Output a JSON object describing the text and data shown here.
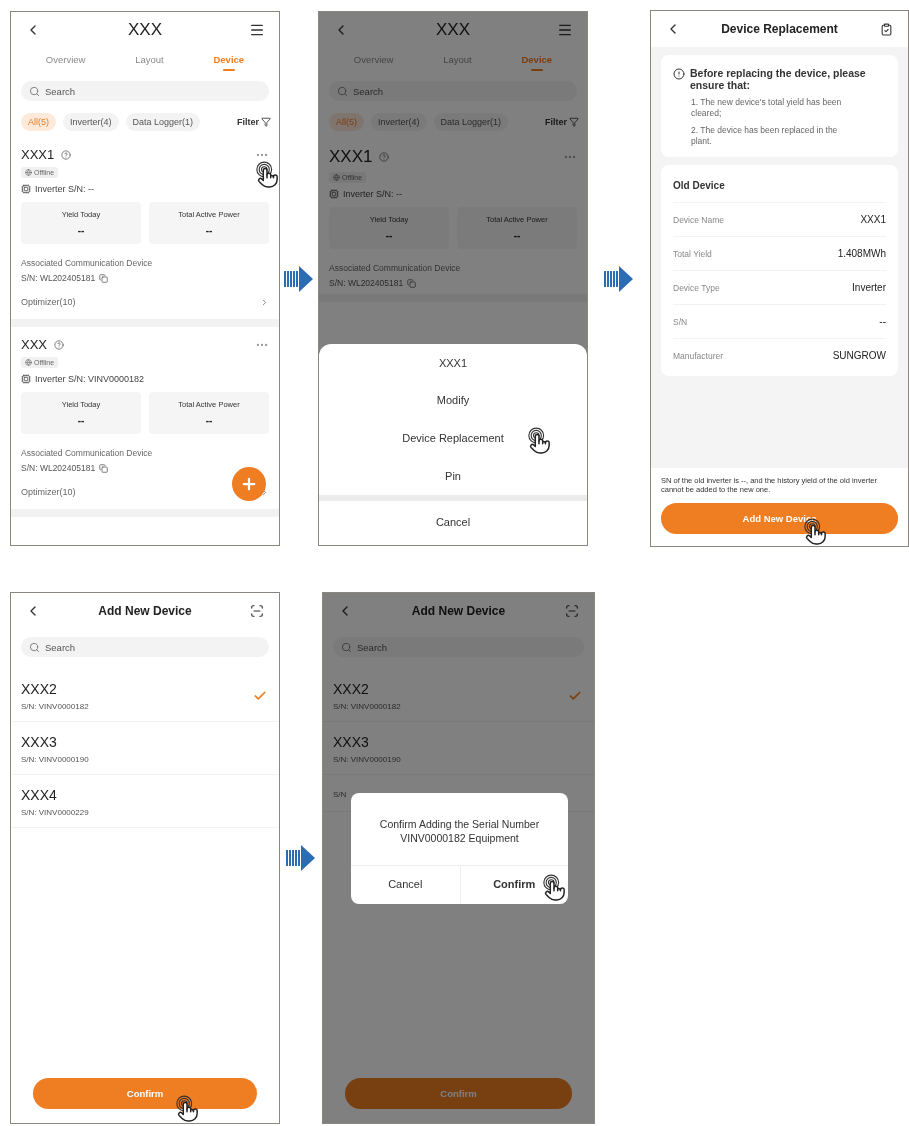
{
  "screens": [
    {
      "kind": "device_list",
      "header": {
        "title": "XXX"
      },
      "tabs": [
        {
          "label": "Overview",
          "selected": false
        },
        {
          "label": "Layout",
          "selected": false
        },
        {
          "label": "Device",
          "selected": true
        }
      ],
      "search": {
        "placeholder": "Search"
      },
      "filters": [
        {
          "label": "All(5)",
          "selected": true
        },
        {
          "label": "Inverter(4)",
          "selected": false
        },
        {
          "label": "Data Logger(1)",
          "selected": false
        }
      ],
      "filter_button": "Filter",
      "devices": [
        {
          "name": "XXX1",
          "status": "Offline",
          "type_sn": "Inverter S/N: --",
          "metrics": [
            {
              "label": "Yield Today",
              "value": "--"
            },
            {
              "label": "Total Active Power",
              "value": "--"
            }
          ],
          "comm_label": "Associated Communication Device",
          "comm_sn": "S/N: WL202405181",
          "optimizer": "Optimizer(10)",
          "tapped": true
        },
        {
          "name": "XXX",
          "status": "Offline",
          "type_sn": "Inverter S/N: VINV0000182",
          "metrics": [
            {
              "label": "Yield Today",
              "value": "--"
            },
            {
              "label": "Total Active Power",
              "value": "--"
            }
          ],
          "comm_label": "Associated Communication Device",
          "comm_sn": "S/N: WL202405181",
          "optimizer": "Optimizer(10)",
          "tapped": false
        }
      ]
    },
    {
      "kind": "device_list",
      "header": {
        "title": "XXX"
      },
      "tabs": [
        {
          "label": "Overview",
          "selected": false
        },
        {
          "label": "Layout",
          "selected": false
        },
        {
          "label": "Device",
          "selected": true
        }
      ],
      "search": {
        "placeholder": "Search"
      },
      "filters": [
        {
          "label": "All(5)",
          "selected": true
        },
        {
          "label": "Inverter(4)",
          "selected": false
        },
        {
          "label": "Data Logger(1)",
          "selected": false
        }
      ],
      "filter_button": "Filter",
      "devices": [
        {
          "name": "XXX1",
          "status": "Offline",
          "type_sn": "Inverter S/N: --",
          "metrics": [
            {
              "label": "Yield Today",
              "value": "--"
            },
            {
              "label": "Total Active Power",
              "value": "--"
            }
          ],
          "comm_label": "Associated Communication Device",
          "comm_sn": "S/N: WL202405181",
          "tapped": false
        }
      ],
      "sheet": {
        "title": "XXX1",
        "options": [
          {
            "label": "Modify",
            "tapped": false
          },
          {
            "label": "Device Replacement",
            "tapped": true
          },
          {
            "label": "Pin",
            "tapped": false
          }
        ],
        "cancel": "Cancel"
      }
    },
    {
      "kind": "replacement",
      "header": {
        "title": "Device Replacement"
      },
      "notice": {
        "heading": "Before replacing the device, please ensure that:",
        "items": [
          "1. The new device's total yield has been cleared;",
          "2. The device has been replaced in the plant."
        ]
      },
      "old_device": {
        "heading": "Old Device",
        "rows": [
          {
            "label": "Device Name",
            "value": "XXX1"
          },
          {
            "label": "Total Yield",
            "value": "1.408MWh"
          },
          {
            "label": "Device Type",
            "value": "Inverter"
          },
          {
            "label": "S/N",
            "value": "--"
          },
          {
            "label": "Manufacturer",
            "value": "SUNGROW"
          }
        ]
      },
      "footnote": "SN of the old inverter is --, and the history yield of the old inverter cannot be added to the new one.",
      "button": {
        "label": "Add New Device",
        "tapped": true
      }
    },
    {
      "kind": "add_device",
      "header": {
        "title": "Add New Device"
      },
      "search": {
        "placeholder": "Search"
      },
      "devices": [
        {
          "name": "XXX2",
          "sn": "S/N: VINV0000182",
          "selected": true
        },
        {
          "name": "XXX3",
          "sn": "S/N: VINV0000190",
          "selected": false
        },
        {
          "name": "XXX4",
          "sn": "S/N: VINV0000229",
          "selected": false
        }
      ],
      "button": {
        "label": "Confirm",
        "tapped": true
      }
    },
    {
      "kind": "add_device",
      "header": {
        "title": "Add New Device"
      },
      "search": {
        "placeholder": "Search"
      },
      "devices": [
        {
          "name": "XXX2",
          "sn": "S/N: VINV0000182",
          "selected": true
        },
        {
          "name": "XXX3",
          "sn": "S/N: VINV0000190",
          "selected": false
        },
        {
          "sn": "S/N",
          "selected": false
        }
      ],
      "dialog": {
        "message": "Confirm Adding the Serial Number VINV0000182 Equipment",
        "buttons": [
          {
            "label": "Cancel",
            "kind": "cancel",
            "tapped": false
          },
          {
            "label": "Confirm",
            "kind": "confirm",
            "tapped": true
          }
        ]
      },
      "button": {
        "label": "Confirm",
        "tapped": false
      }
    }
  ]
}
